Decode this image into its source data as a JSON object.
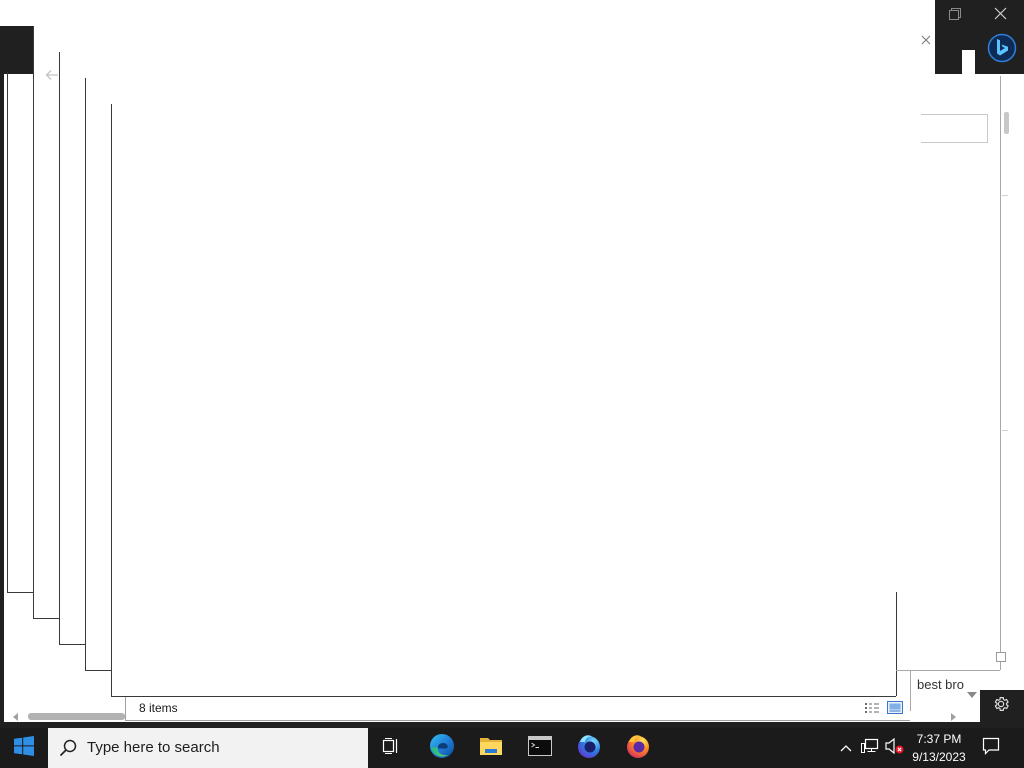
{
  "colors": {
    "desktop": "#202020",
    "taskbar": "#1b1b1b",
    "windows_logo": "#2f8fe6",
    "taskbar_search": "#f2f2f2",
    "page": "#ffffff",
    "mute_badge": "#e81123"
  },
  "browser": {
    "controls": {
      "restore_icon": "restore-icon",
      "close_icon": "close-icon"
    },
    "tab_close_icon": "close-icon",
    "back_icon": "back-arrow-icon",
    "sidebar": {
      "copilot_icon": "bing-icon",
      "settings_icon": "gear-icon"
    },
    "find_box": {
      "value": ""
    },
    "suggestion": {
      "text": "best bro",
      "dropdown_icon": "chevron-down-icon"
    },
    "scrollbar": {
      "left_icon": "scroll-left-icon",
      "right_icon": "scroll-right-icon"
    }
  },
  "explorer": {
    "status_text": "8 items",
    "view_icons": [
      "details-view-icon",
      "large-icons-view-icon"
    ]
  },
  "taskbar": {
    "start_icon": "windows-logo-icon",
    "search": {
      "icon": "search-icon",
      "placeholder": "Type here to search"
    },
    "pinned": [
      "task-view-icon",
      "edge-icon",
      "file-explorer-icon",
      "terminal-icon",
      "firefox-developer-edition-icon",
      "firefox-icon"
    ],
    "tray": {
      "icons": [
        "chevron-up-icon",
        "network-icon",
        "volume-muted-icon"
      ],
      "time": "7:37 PM",
      "date": "9/13/2023",
      "notification_icon": "notification-icon"
    }
  }
}
